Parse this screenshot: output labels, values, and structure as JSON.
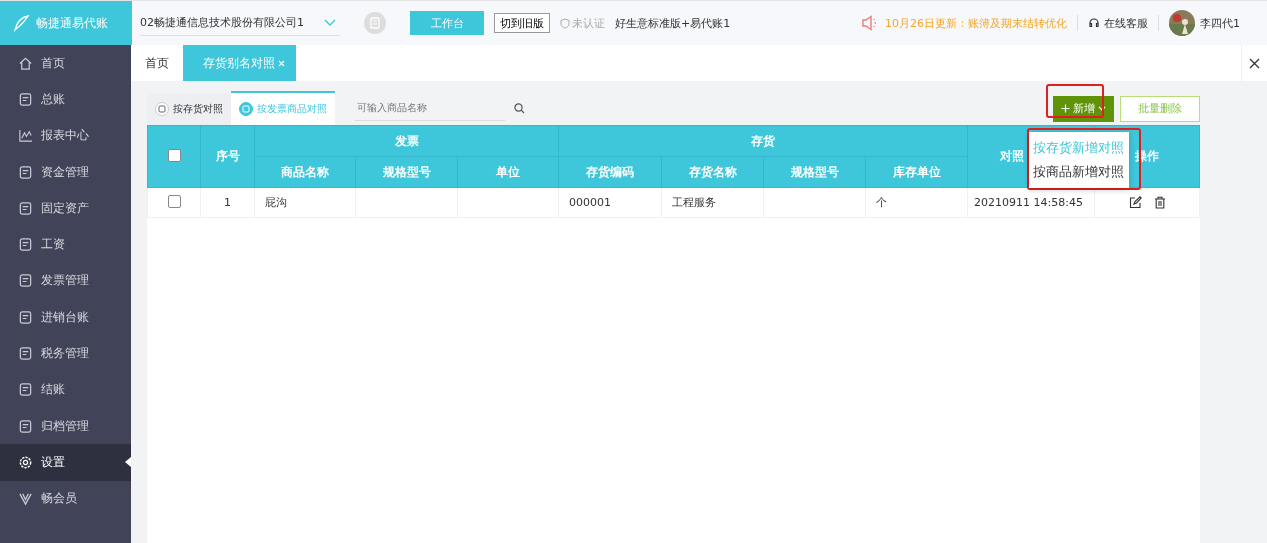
{
  "header": {
    "logo": "畅捷通易代账",
    "company": "02畅捷通信息技术股份有限公司1",
    "workbench_button": "工作台",
    "switch_button": "切到旧版",
    "cert_status": "未认证",
    "edition": "好生意标准版+易代账1",
    "notice": "10月26日更新：账簿及期末结转优化",
    "support": "在线客服",
    "user": "李四代1"
  },
  "sidebar": {
    "items": [
      {
        "label": "首页",
        "kind": "home",
        "selected": false
      },
      {
        "label": "总账",
        "kind": "doc",
        "selected": false
      },
      {
        "label": "报表中心",
        "kind": "chart",
        "selected": false
      },
      {
        "label": "资金管理",
        "kind": "doc",
        "selected": false
      },
      {
        "label": "固定资产",
        "kind": "doc",
        "selected": false
      },
      {
        "label": "工资",
        "kind": "doc",
        "selected": false
      },
      {
        "label": "发票管理",
        "kind": "doc",
        "selected": false
      },
      {
        "label": "进销台账",
        "kind": "doc",
        "selected": false
      },
      {
        "label": "税务管理",
        "kind": "doc",
        "selected": false
      },
      {
        "label": "结账",
        "kind": "doc",
        "selected": false
      },
      {
        "label": "归档管理",
        "kind": "doc",
        "selected": false
      },
      {
        "label": "设置",
        "kind": "gear",
        "selected": true
      },
      {
        "label": "畅会员",
        "kind": "v",
        "selected": false
      }
    ]
  },
  "page_tabs": [
    {
      "label": "首页",
      "selected": false,
      "closable": false
    },
    {
      "label": "存货别名对照",
      "selected": true,
      "closable": true
    }
  ],
  "sub_tabs": [
    {
      "label": "按存货对照",
      "selected": false
    },
    {
      "label": "按发票商品对照",
      "selected": true
    }
  ],
  "search": {
    "placeholder": "可输入商品名称"
  },
  "actions": {
    "add_button": "新增",
    "batch_delete_button": "批量删除"
  },
  "add_menu": [
    {
      "label": "按存货新增对照",
      "selected": true
    },
    {
      "label": "按商品新增对照",
      "selected": false
    }
  ],
  "table": {
    "select_all_checked": false,
    "index_header": "序号",
    "groups": [
      {
        "label": "发票",
        "columns": [
          "商品名称",
          "规格型号",
          "单位"
        ]
      },
      {
        "label": "存货",
        "columns": [
          "存货编码",
          "存货名称",
          "规格型号",
          "库存单位"
        ]
      }
    ],
    "time_header": "对照",
    "action_header": "操作",
    "rows": [
      {
        "checked": false,
        "index": "1",
        "invoice_name": "屁沟",
        "inventory_code": "000001",
        "inventory_name": "工程服务",
        "stock_unit": "个",
        "time": "20210911 14:58:45"
      }
    ]
  }
}
